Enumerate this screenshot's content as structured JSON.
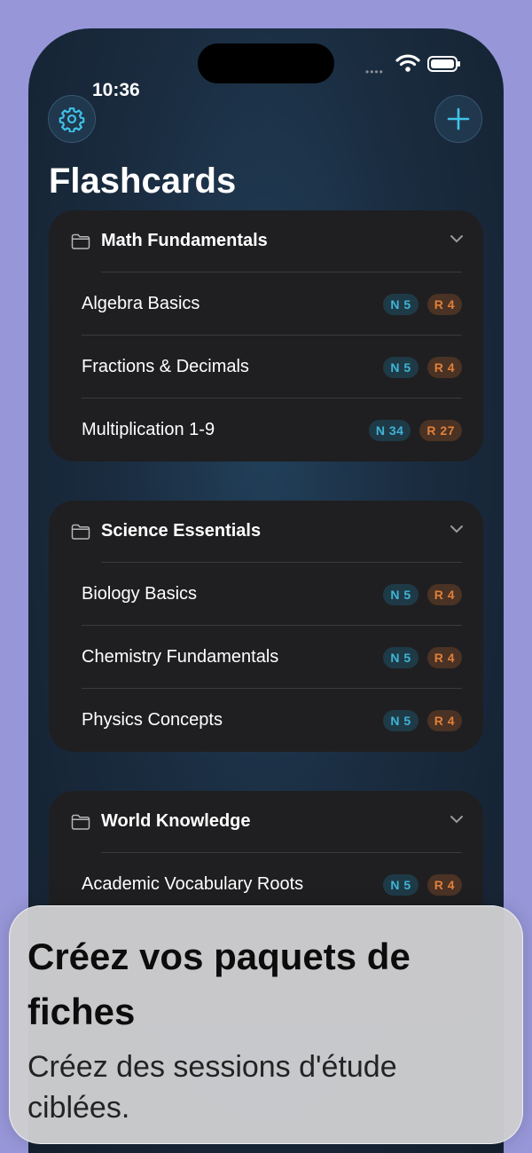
{
  "status": {
    "time": "10:36"
  },
  "header": {
    "title": "Flashcards"
  },
  "decks": [
    {
      "title": "Math Fundamentals",
      "items": [
        {
          "label": "Algebra Basics",
          "new": "N 5",
          "review": "R 4"
        },
        {
          "label": "Fractions & Decimals",
          "new": "N 5",
          "review": "R 4"
        },
        {
          "label": "Multiplication 1-9",
          "new": "N 34",
          "review": "R 27"
        }
      ]
    },
    {
      "title": "Science Essentials",
      "items": [
        {
          "label": "Biology Basics",
          "new": "N 5",
          "review": "R 4"
        },
        {
          "label": "Chemistry Fundamentals",
          "new": "N 5",
          "review": "R 4"
        },
        {
          "label": "Physics Concepts",
          "new": "N 5",
          "review": "R 4"
        }
      ]
    },
    {
      "title": "World Knowledge",
      "items": [
        {
          "label": "Academic Vocabulary Roots",
          "new": "N 5",
          "review": "R 4"
        }
      ]
    }
  ],
  "toast": {
    "title": "Créez vos paquets de fiches",
    "subtitle": "Créez des sessions d'étude ciblées."
  },
  "colors": {
    "accent": "#3fc3ea",
    "new_badge": "#3fb4d6",
    "review_badge": "#e0803a",
    "background": "#9796d8"
  }
}
